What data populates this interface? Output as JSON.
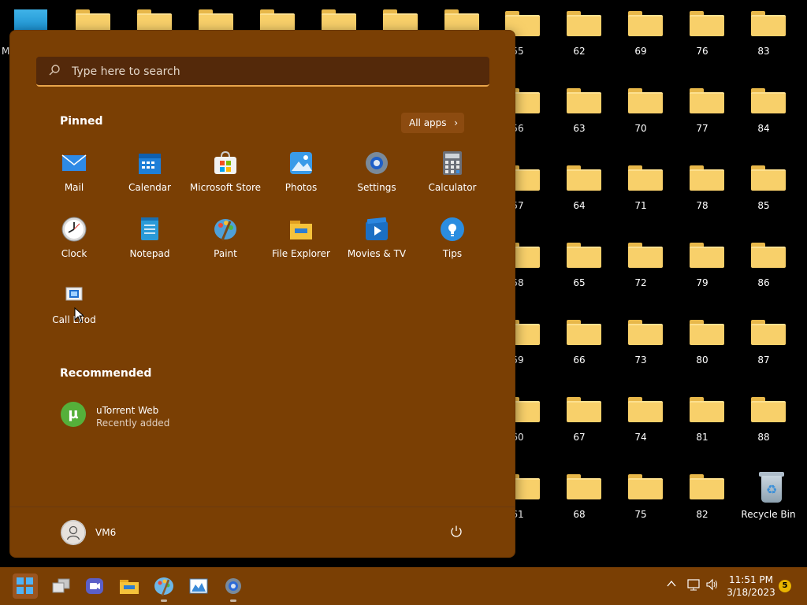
{
  "desktop": {
    "partial_label": "M",
    "folders": [
      {
        "label": "55"
      },
      {
        "label": "56"
      },
      {
        "label": "57"
      },
      {
        "label": "58"
      },
      {
        "label": "59"
      },
      {
        "label": "60"
      },
      {
        "label": "61"
      },
      {
        "label": "62"
      },
      {
        "label": "63"
      },
      {
        "label": "64"
      },
      {
        "label": "65"
      },
      {
        "label": "66"
      },
      {
        "label": "67"
      },
      {
        "label": "68"
      },
      {
        "label": "69"
      },
      {
        "label": "70"
      },
      {
        "label": "71"
      },
      {
        "label": "72"
      },
      {
        "label": "73"
      },
      {
        "label": "74"
      },
      {
        "label": "75"
      },
      {
        "label": "76"
      },
      {
        "label": "77"
      },
      {
        "label": "78"
      },
      {
        "label": "79"
      },
      {
        "label": "80"
      },
      {
        "label": "81"
      },
      {
        "label": "82"
      },
      {
        "label": "83"
      },
      {
        "label": "84"
      },
      {
        "label": "85"
      },
      {
        "label": "86"
      },
      {
        "label": "87"
      },
      {
        "label": "88"
      }
    ],
    "recycle_bin_label": "Recycle Bin"
  },
  "start_menu": {
    "search_placeholder": "Type here to search",
    "pinned_title": "Pinned",
    "all_apps_label": "All apps",
    "pinned_apps": [
      {
        "label": "Mail",
        "icon": "mail-icon",
        "color": "#2e8ae6"
      },
      {
        "label": "Calendar",
        "icon": "calendar-icon",
        "color": "#1e7fd8"
      },
      {
        "label": "Microsoft Store",
        "icon": "store-icon",
        "color": "#f2f2f2"
      },
      {
        "label": "Photos",
        "icon": "photos-icon",
        "color": "#3a9be8"
      },
      {
        "label": "Settings",
        "icon": "settings-icon",
        "color": "#7a8a9a"
      },
      {
        "label": "Calculator",
        "icon": "calculator-icon",
        "color": "#6b6f78"
      },
      {
        "label": "Clock",
        "icon": "clock-icon",
        "color": "#d8d8d8"
      },
      {
        "label": "Notepad",
        "icon": "notepad-icon",
        "color": "#2a9ad8"
      },
      {
        "label": "Paint",
        "icon": "paint-icon",
        "color": "#4fa0d8"
      },
      {
        "label": "File Explorer",
        "icon": "file-explorer-icon",
        "color": "#f5c23a"
      },
      {
        "label": "Movies & TV",
        "icon": "movies-tv-icon",
        "color": "#1b6fc4"
      },
      {
        "label": "Tips",
        "icon": "tips-icon",
        "color": "#2b8de0"
      },
      {
        "label": "Call Lifod",
        "icon": "call-app-icon",
        "color": "#f0f0f0"
      }
    ],
    "recommended_title": "Recommended",
    "recommended": [
      {
        "title": "uTorrent Web",
        "subtitle": "Recently added",
        "icon": "utorrent-icon",
        "glyph": "µ"
      }
    ],
    "user_name": "VM6"
  },
  "taskbar": {
    "apps": [
      {
        "name": "task-view",
        "icon": "task-view-icon"
      },
      {
        "name": "teams",
        "icon": "teams-icon"
      },
      {
        "name": "file-explorer",
        "icon": "file-explorer-icon"
      },
      {
        "name": "paint",
        "icon": "paint-icon"
      },
      {
        "name": "photo-viewer",
        "icon": "photo-viewer-icon"
      },
      {
        "name": "settings",
        "icon": "settings-icon"
      }
    ],
    "time": "11:51 PM",
    "date": "3/18/2023",
    "notification_count": "5"
  },
  "colors": {
    "accent": "#7a3f04",
    "folder": "#f8d06a"
  }
}
